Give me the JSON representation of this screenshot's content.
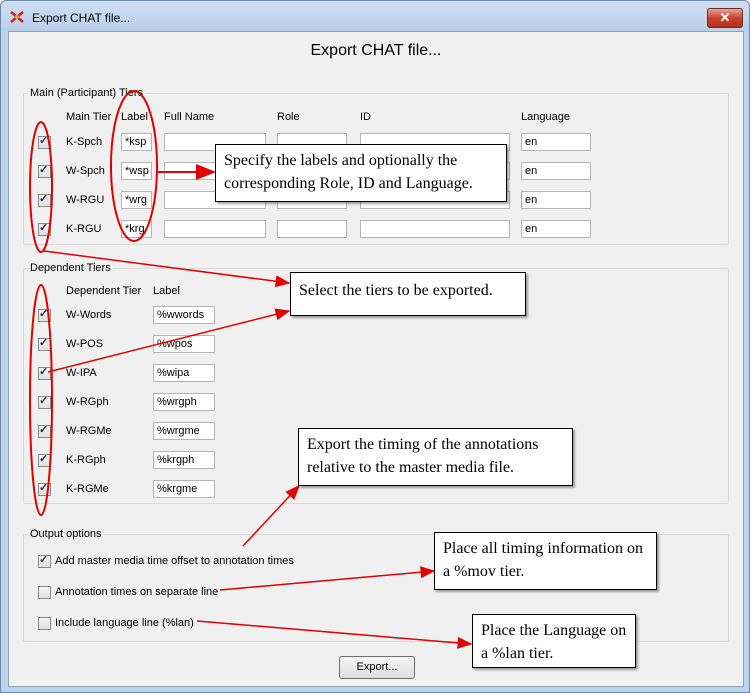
{
  "window": {
    "title": "Export CHAT file...",
    "close_symbol": "✕"
  },
  "dialog": {
    "heading": "Export CHAT file..."
  },
  "main_tiers": {
    "group_label": "Main (Participant) Tiers",
    "headers": {
      "main_tier": "Main Tier",
      "label": "Label",
      "full_name": "Full Name",
      "role": "Role",
      "id": "ID",
      "language": "Language"
    },
    "rows": [
      {
        "name": "K-Spch",
        "label": "*ksp",
        "language": "en",
        "checked": true
      },
      {
        "name": "W-Spch",
        "label": "*wsp",
        "language": "en",
        "checked": true
      },
      {
        "name": "W-RGU",
        "label": "*wrg",
        "language": "en",
        "checked": true
      },
      {
        "name": "K-RGU",
        "label": "*krg",
        "language": "en",
        "checked": true
      }
    ]
  },
  "dependent_tiers": {
    "group_label": "Dependent Tiers",
    "headers": {
      "dependent_tier": "Dependent Tier",
      "label": "Label"
    },
    "rows": [
      {
        "name": "W-Words",
        "label": "%wwords",
        "checked": true
      },
      {
        "name": "W-POS",
        "label": "%wpos",
        "checked": true
      },
      {
        "name": "W-IPA",
        "label": "%wipa",
        "checked": true
      },
      {
        "name": "W-RGph",
        "label": "%wrgph",
        "checked": true
      },
      {
        "name": "W-RGMe",
        "label": "%wrgme",
        "checked": true
      },
      {
        "name": "K-RGph",
        "label": "%krgph",
        "checked": true
      },
      {
        "name": "K-RGMe",
        "label": "%krgme",
        "checked": true
      }
    ]
  },
  "output_options": {
    "group_label": "Output options",
    "options": [
      {
        "label": "Add master media time offset to annotation times",
        "checked": true
      },
      {
        "label": "Annotation times on separate line",
        "checked": false
      },
      {
        "label": "Include language line (%lan)",
        "checked": false
      }
    ]
  },
  "export_button": "Export...",
  "callouts": {
    "labels": "Specify the labels and optionally the corresponding Role, ID and Language.",
    "tiers": "Select the tiers to be exported.",
    "timing": "Export the timing of the annotations relative to the master media file.",
    "mov": "Place all timing information on a %mov tier.",
    "lan": "Place the Language on a %lan tier."
  },
  "colors": {
    "annotation": "#e00000",
    "title_bar": "#bcd3ec",
    "close_button": "#c8432f"
  }
}
